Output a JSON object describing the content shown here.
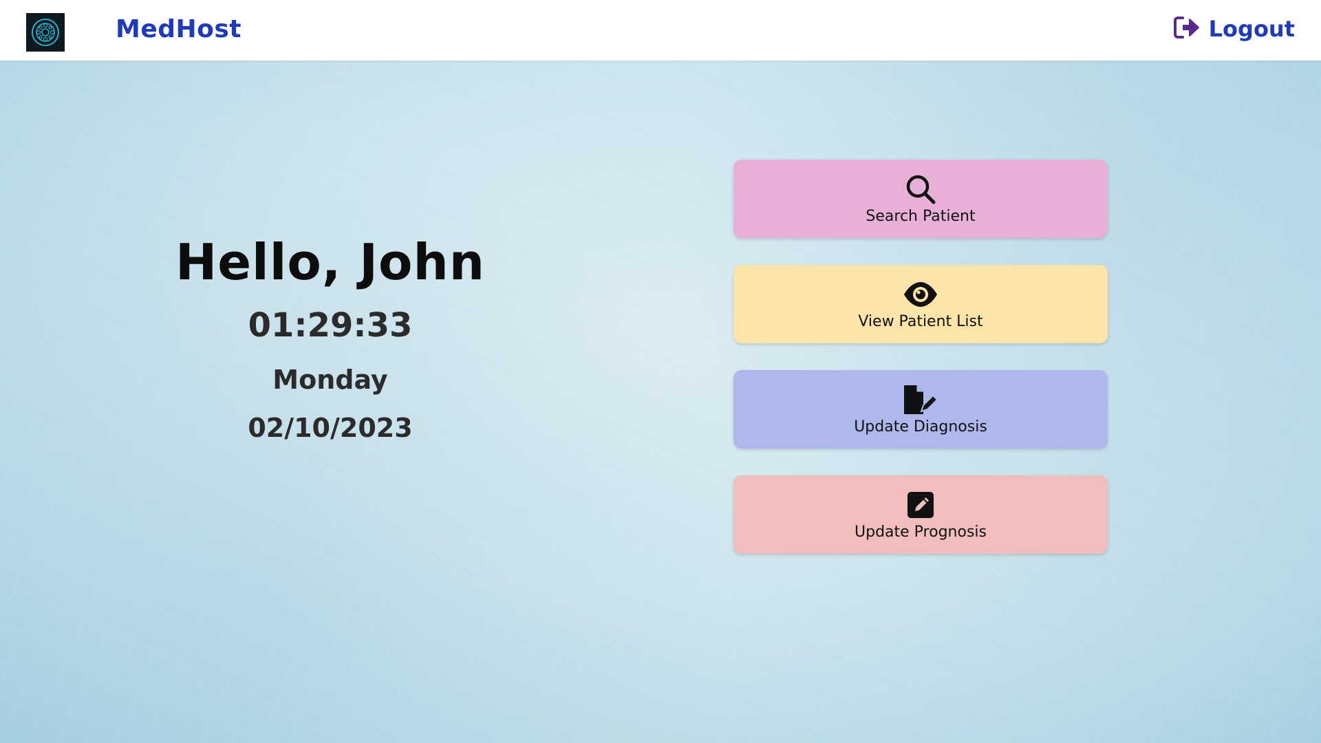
{
  "app": {
    "brand": "MedHost",
    "logo_icon": "medical-emblem-icon",
    "logout_label": "Logout",
    "logout_icon": "sign-out-icon"
  },
  "greeting": {
    "hello": "Hello, John",
    "time": "01:29:33",
    "day": "Monday",
    "date": "02/10/2023"
  },
  "actions": [
    {
      "label": "Search Patient",
      "icon": "search-icon",
      "color": "#e9b0d7"
    },
    {
      "label": "View Patient List",
      "icon": "eye-icon",
      "color": "#fde4ab"
    },
    {
      "label": "Update Diagnosis",
      "icon": "file-edit-icon",
      "color": "#aeb8ec"
    },
    {
      "label": "Update Prognosis",
      "icon": "edit-square-icon",
      "color": "#f1bdbd"
    }
  ],
  "colors": {
    "brand": "#1f3bb5",
    "logout_icon": "#5a2a8a"
  }
}
